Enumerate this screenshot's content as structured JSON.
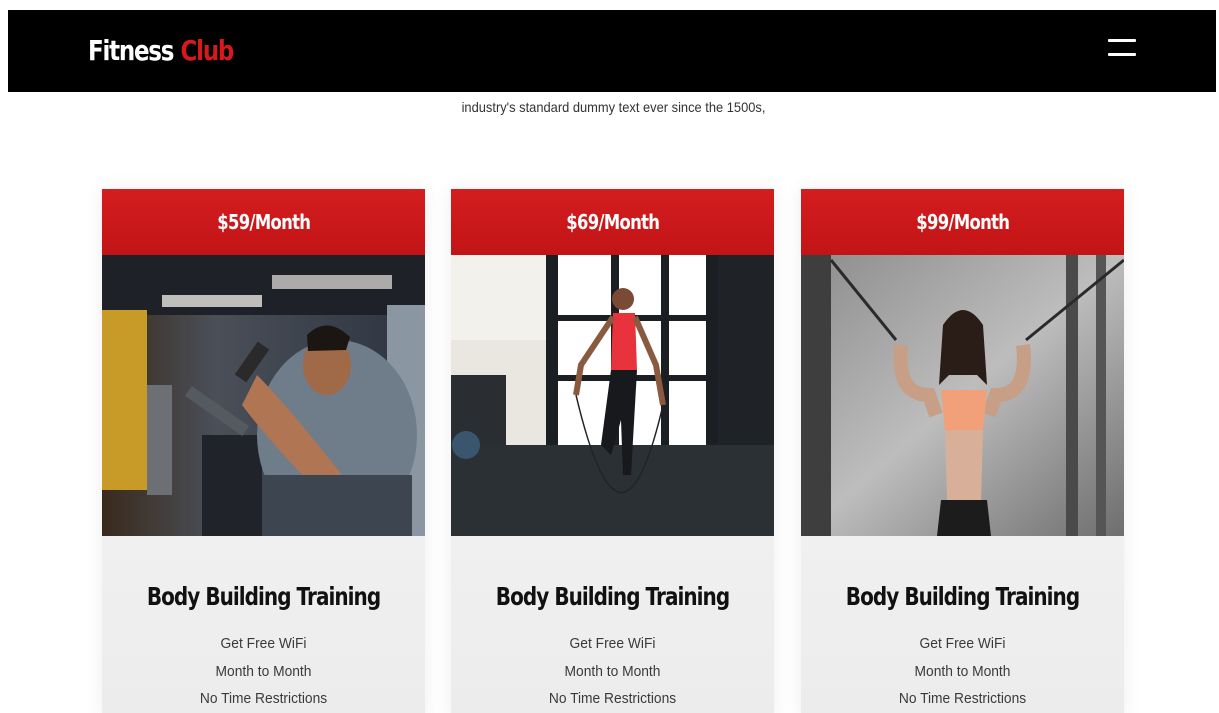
{
  "header": {
    "logo_word1": "Fitness",
    "logo_word2": "Club",
    "menu_icon": "hamburger-menu-icon"
  },
  "intro": {
    "text": "industry's standard dummy text ever since the 1500s,"
  },
  "plans": [
    {
      "price": "$59/Month",
      "image": "man-bicep-curl-machine-photo",
      "title": "Body Building Training",
      "features": [
        "Get Free WiFi",
        "Month to Month",
        "No Time Restrictions"
      ]
    },
    {
      "price": "$69/Month",
      "image": "woman-jump-rope-photo",
      "title": "Body Building Training",
      "features": [
        "Get Free WiFi",
        "Month to Month",
        "No Time Restrictions"
      ]
    },
    {
      "price": "$99/Month",
      "image": "woman-cable-machine-photo",
      "title": "Body Building Training",
      "features": [
        "Get Free WiFi",
        "Month to Month",
        "No Time Restrictions"
      ]
    }
  ],
  "colors": {
    "navbar": "#000000",
    "accent_red": "#d41d1f",
    "logo_white": "#ffffff",
    "title_text": "#111111",
    "feature_text": "#3a3a3a"
  }
}
